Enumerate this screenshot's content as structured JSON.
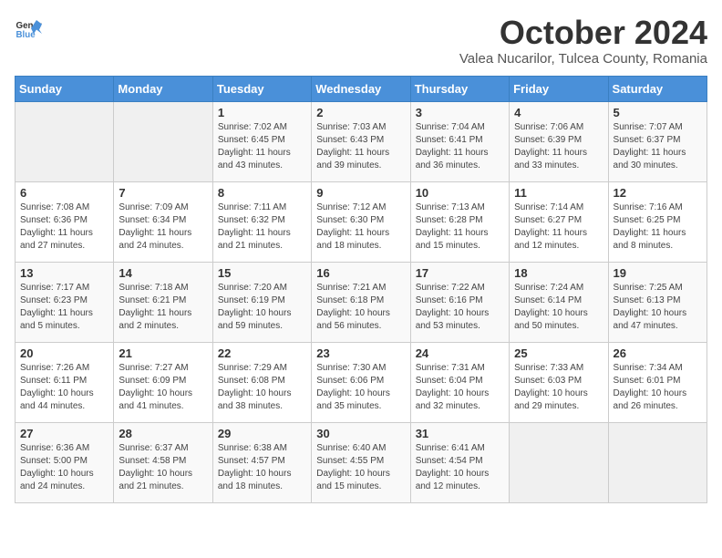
{
  "header": {
    "logo_general": "General",
    "logo_blue": "Blue",
    "month": "October 2024",
    "location": "Valea Nucarilor, Tulcea County, Romania"
  },
  "weekdays": [
    "Sunday",
    "Monday",
    "Tuesday",
    "Wednesday",
    "Thursday",
    "Friday",
    "Saturday"
  ],
  "weeks": [
    [
      {
        "day": "",
        "sunrise": "",
        "sunset": "",
        "daylight": ""
      },
      {
        "day": "",
        "sunrise": "",
        "sunset": "",
        "daylight": ""
      },
      {
        "day": "1",
        "sunrise": "Sunrise: 7:02 AM",
        "sunset": "Sunset: 6:45 PM",
        "daylight": "Daylight: 11 hours and 43 minutes."
      },
      {
        "day": "2",
        "sunrise": "Sunrise: 7:03 AM",
        "sunset": "Sunset: 6:43 PM",
        "daylight": "Daylight: 11 hours and 39 minutes."
      },
      {
        "day": "3",
        "sunrise": "Sunrise: 7:04 AM",
        "sunset": "Sunset: 6:41 PM",
        "daylight": "Daylight: 11 hours and 36 minutes."
      },
      {
        "day": "4",
        "sunrise": "Sunrise: 7:06 AM",
        "sunset": "Sunset: 6:39 PM",
        "daylight": "Daylight: 11 hours and 33 minutes."
      },
      {
        "day": "5",
        "sunrise": "Sunrise: 7:07 AM",
        "sunset": "Sunset: 6:37 PM",
        "daylight": "Daylight: 11 hours and 30 minutes."
      }
    ],
    [
      {
        "day": "6",
        "sunrise": "Sunrise: 7:08 AM",
        "sunset": "Sunset: 6:36 PM",
        "daylight": "Daylight: 11 hours and 27 minutes."
      },
      {
        "day": "7",
        "sunrise": "Sunrise: 7:09 AM",
        "sunset": "Sunset: 6:34 PM",
        "daylight": "Daylight: 11 hours and 24 minutes."
      },
      {
        "day": "8",
        "sunrise": "Sunrise: 7:11 AM",
        "sunset": "Sunset: 6:32 PM",
        "daylight": "Daylight: 11 hours and 21 minutes."
      },
      {
        "day": "9",
        "sunrise": "Sunrise: 7:12 AM",
        "sunset": "Sunset: 6:30 PM",
        "daylight": "Daylight: 11 hours and 18 minutes."
      },
      {
        "day": "10",
        "sunrise": "Sunrise: 7:13 AM",
        "sunset": "Sunset: 6:28 PM",
        "daylight": "Daylight: 11 hours and 15 minutes."
      },
      {
        "day": "11",
        "sunrise": "Sunrise: 7:14 AM",
        "sunset": "Sunset: 6:27 PM",
        "daylight": "Daylight: 11 hours and 12 minutes."
      },
      {
        "day": "12",
        "sunrise": "Sunrise: 7:16 AM",
        "sunset": "Sunset: 6:25 PM",
        "daylight": "Daylight: 11 hours and 8 minutes."
      }
    ],
    [
      {
        "day": "13",
        "sunrise": "Sunrise: 7:17 AM",
        "sunset": "Sunset: 6:23 PM",
        "daylight": "Daylight: 11 hours and 5 minutes."
      },
      {
        "day": "14",
        "sunrise": "Sunrise: 7:18 AM",
        "sunset": "Sunset: 6:21 PM",
        "daylight": "Daylight: 11 hours and 2 minutes."
      },
      {
        "day": "15",
        "sunrise": "Sunrise: 7:20 AM",
        "sunset": "Sunset: 6:19 PM",
        "daylight": "Daylight: 10 hours and 59 minutes."
      },
      {
        "day": "16",
        "sunrise": "Sunrise: 7:21 AM",
        "sunset": "Sunset: 6:18 PM",
        "daylight": "Daylight: 10 hours and 56 minutes."
      },
      {
        "day": "17",
        "sunrise": "Sunrise: 7:22 AM",
        "sunset": "Sunset: 6:16 PM",
        "daylight": "Daylight: 10 hours and 53 minutes."
      },
      {
        "day": "18",
        "sunrise": "Sunrise: 7:24 AM",
        "sunset": "Sunset: 6:14 PM",
        "daylight": "Daylight: 10 hours and 50 minutes."
      },
      {
        "day": "19",
        "sunrise": "Sunrise: 7:25 AM",
        "sunset": "Sunset: 6:13 PM",
        "daylight": "Daylight: 10 hours and 47 minutes."
      }
    ],
    [
      {
        "day": "20",
        "sunrise": "Sunrise: 7:26 AM",
        "sunset": "Sunset: 6:11 PM",
        "daylight": "Daylight: 10 hours and 44 minutes."
      },
      {
        "day": "21",
        "sunrise": "Sunrise: 7:27 AM",
        "sunset": "Sunset: 6:09 PM",
        "daylight": "Daylight: 10 hours and 41 minutes."
      },
      {
        "day": "22",
        "sunrise": "Sunrise: 7:29 AM",
        "sunset": "Sunset: 6:08 PM",
        "daylight": "Daylight: 10 hours and 38 minutes."
      },
      {
        "day": "23",
        "sunrise": "Sunrise: 7:30 AM",
        "sunset": "Sunset: 6:06 PM",
        "daylight": "Daylight: 10 hours and 35 minutes."
      },
      {
        "day": "24",
        "sunrise": "Sunrise: 7:31 AM",
        "sunset": "Sunset: 6:04 PM",
        "daylight": "Daylight: 10 hours and 32 minutes."
      },
      {
        "day": "25",
        "sunrise": "Sunrise: 7:33 AM",
        "sunset": "Sunset: 6:03 PM",
        "daylight": "Daylight: 10 hours and 29 minutes."
      },
      {
        "day": "26",
        "sunrise": "Sunrise: 7:34 AM",
        "sunset": "Sunset: 6:01 PM",
        "daylight": "Daylight: 10 hours and 26 minutes."
      }
    ],
    [
      {
        "day": "27",
        "sunrise": "Sunrise: 6:36 AM",
        "sunset": "Sunset: 5:00 PM",
        "daylight": "Daylight: 10 hours and 24 minutes."
      },
      {
        "day": "28",
        "sunrise": "Sunrise: 6:37 AM",
        "sunset": "Sunset: 4:58 PM",
        "daylight": "Daylight: 10 hours and 21 minutes."
      },
      {
        "day": "29",
        "sunrise": "Sunrise: 6:38 AM",
        "sunset": "Sunset: 4:57 PM",
        "daylight": "Daylight: 10 hours and 18 minutes."
      },
      {
        "day": "30",
        "sunrise": "Sunrise: 6:40 AM",
        "sunset": "Sunset: 4:55 PM",
        "daylight": "Daylight: 10 hours and 15 minutes."
      },
      {
        "day": "31",
        "sunrise": "Sunrise: 6:41 AM",
        "sunset": "Sunset: 4:54 PM",
        "daylight": "Daylight: 10 hours and 12 minutes."
      },
      {
        "day": "",
        "sunrise": "",
        "sunset": "",
        "daylight": ""
      },
      {
        "day": "",
        "sunrise": "",
        "sunset": "",
        "daylight": ""
      }
    ]
  ]
}
